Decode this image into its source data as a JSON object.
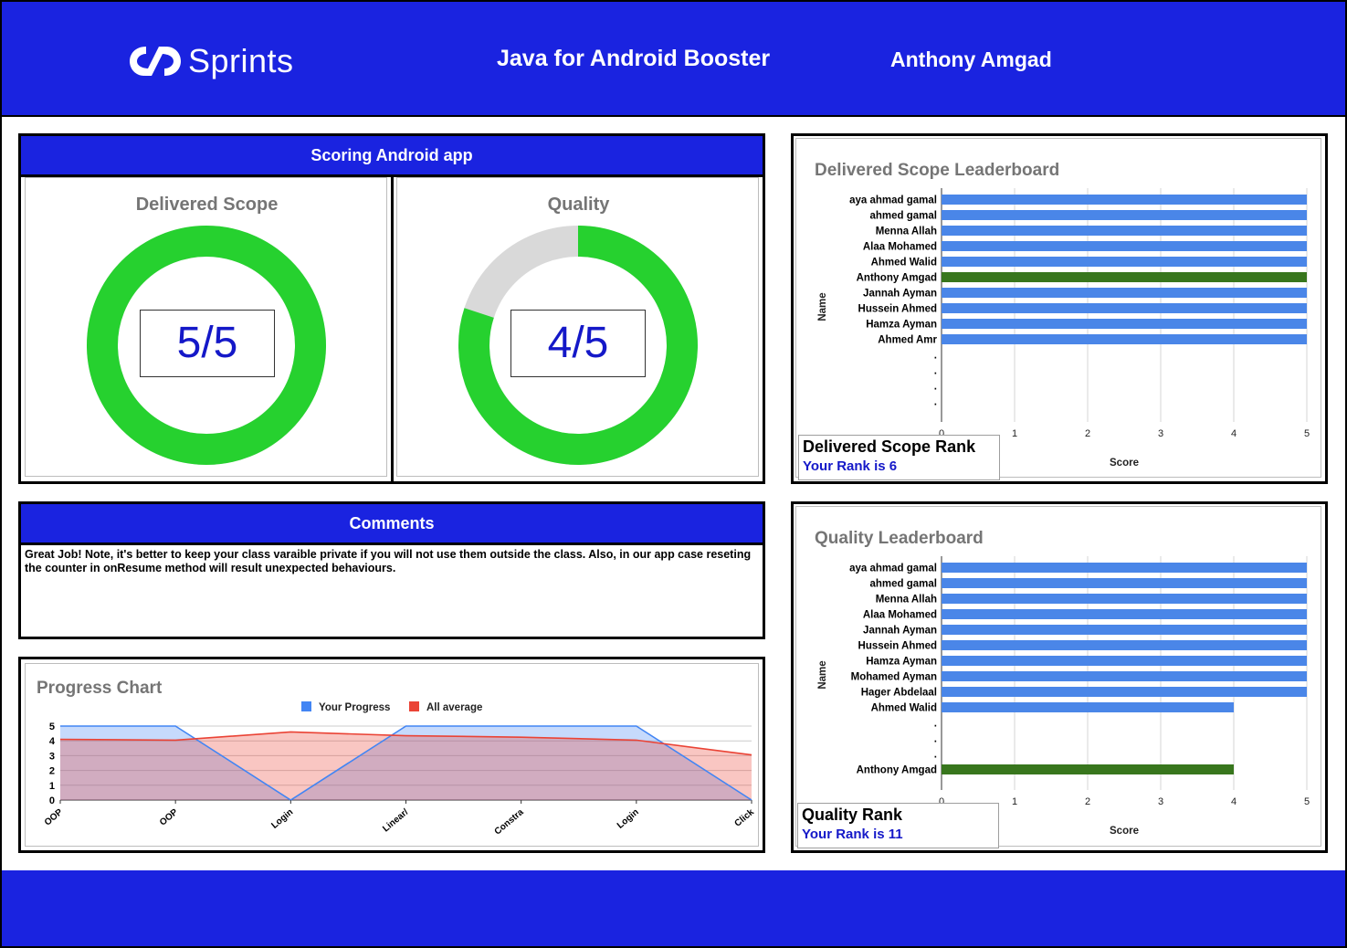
{
  "header": {
    "logo_text": "Sprints",
    "course_title": "Java for Android Booster",
    "student_name": "Anthony Amgad"
  },
  "scoring": {
    "title": "Scoring Android app",
    "delivered_scope": {
      "title": "Delivered Scope",
      "score_text": "5/5",
      "value": 5,
      "max": 5
    },
    "quality": {
      "title": "Quality",
      "score_text": "4/5",
      "value": 4,
      "max": 5
    },
    "colors": {
      "filled": "#26d12f",
      "empty": "#d9d9d9"
    }
  },
  "comments": {
    "title": "Comments",
    "text": "Great Job! Note, it's better to keep your class varaible private if you will not use them outside the class. Also, in our app case reseting the counter in onResume method will result unexpected behaviours."
  },
  "delivered_rank": {
    "title": "Delivered Scope Rank",
    "value": "Your Rank is 6"
  },
  "quality_rank": {
    "title": "Quality Rank",
    "value": "Your Rank is 11"
  },
  "chart_data": [
    {
      "id": "progress",
      "type": "area",
      "title": "Progress Chart",
      "categories": [
        "OOP",
        "OOP",
        "Login",
        "Linear/",
        "Constra",
        "Login",
        "Click"
      ],
      "series": [
        {
          "name": "Your Progress",
          "color": "#4285f4",
          "values": [
            5,
            5,
            0,
            5,
            5,
            5,
            0
          ]
        },
        {
          "name": "All average",
          "color": "#ea4335",
          "values": [
            4.1,
            4.05,
            4.6,
            4.35,
            4.25,
            4.05,
            3.05
          ]
        }
      ],
      "ylim": [
        0,
        5
      ],
      "yticks": [
        "0",
        "1",
        "2",
        "3",
        "4",
        "5"
      ],
      "legend": "top"
    },
    {
      "id": "delivered",
      "type": "bar",
      "orientation": "horizontal",
      "title": "Delivered Scope Leaderboard",
      "xlabel": "Score",
      "ylabel": "Name",
      "xlim": [
        0,
        5
      ],
      "xticks": [
        "0",
        "1",
        "2",
        "3",
        "4",
        "5"
      ],
      "highlight_color": "#38761d",
      "bar_color": "#4a86e8",
      "rows": [
        {
          "name": "aya ahmad gamal",
          "value": 5
        },
        {
          "name": "ahmed gamal",
          "value": 5
        },
        {
          "name": "Menna Allah",
          "value": 5
        },
        {
          "name": "Alaa Mohamed",
          "value": 5
        },
        {
          "name": "Ahmed Walid",
          "value": 5
        },
        {
          "name": "Anthony Amgad",
          "value": 5,
          "highlight": true
        },
        {
          "name": "Jannah Ayman",
          "value": 5
        },
        {
          "name": "Hussein Ahmed",
          "value": 5
        },
        {
          "name": "Hamza Ayman",
          "value": 5
        },
        {
          "name": "Ahmed Amr",
          "value": 5
        },
        {
          "name": ".",
          "value": 0
        },
        {
          "name": ".",
          "value": 0
        },
        {
          "name": ".",
          "value": 0
        },
        {
          "name": ".",
          "value": 0
        }
      ]
    },
    {
      "id": "quality",
      "type": "bar",
      "orientation": "horizontal",
      "title": "Quality Leaderboard",
      "xlabel": "Score",
      "ylabel": "Name",
      "xlim": [
        0,
        5
      ],
      "xticks": [
        "0",
        "1",
        "2",
        "3",
        "4",
        "5"
      ],
      "highlight_color": "#38761d",
      "bar_color": "#4a86e8",
      "rows": [
        {
          "name": "aya ahmad gamal",
          "value": 5
        },
        {
          "name": "ahmed gamal",
          "value": 5
        },
        {
          "name": "Menna Allah",
          "value": 5
        },
        {
          "name": "Alaa Mohamed",
          "value": 5
        },
        {
          "name": "Jannah Ayman",
          "value": 5
        },
        {
          "name": "Hussein Ahmed",
          "value": 5
        },
        {
          "name": "Hamza Ayman",
          "value": 5
        },
        {
          "name": "Mohamed Ayman",
          "value": 5
        },
        {
          "name": "Hager Abdelaal",
          "value": 5
        },
        {
          "name": "Ahmed Walid",
          "value": 4
        },
        {
          "name": ".",
          "value": 0
        },
        {
          "name": ".",
          "value": 0
        },
        {
          "name": ".",
          "value": 0
        },
        {
          "name": "Anthony Amgad",
          "value": 4,
          "highlight": true
        }
      ]
    }
  ]
}
